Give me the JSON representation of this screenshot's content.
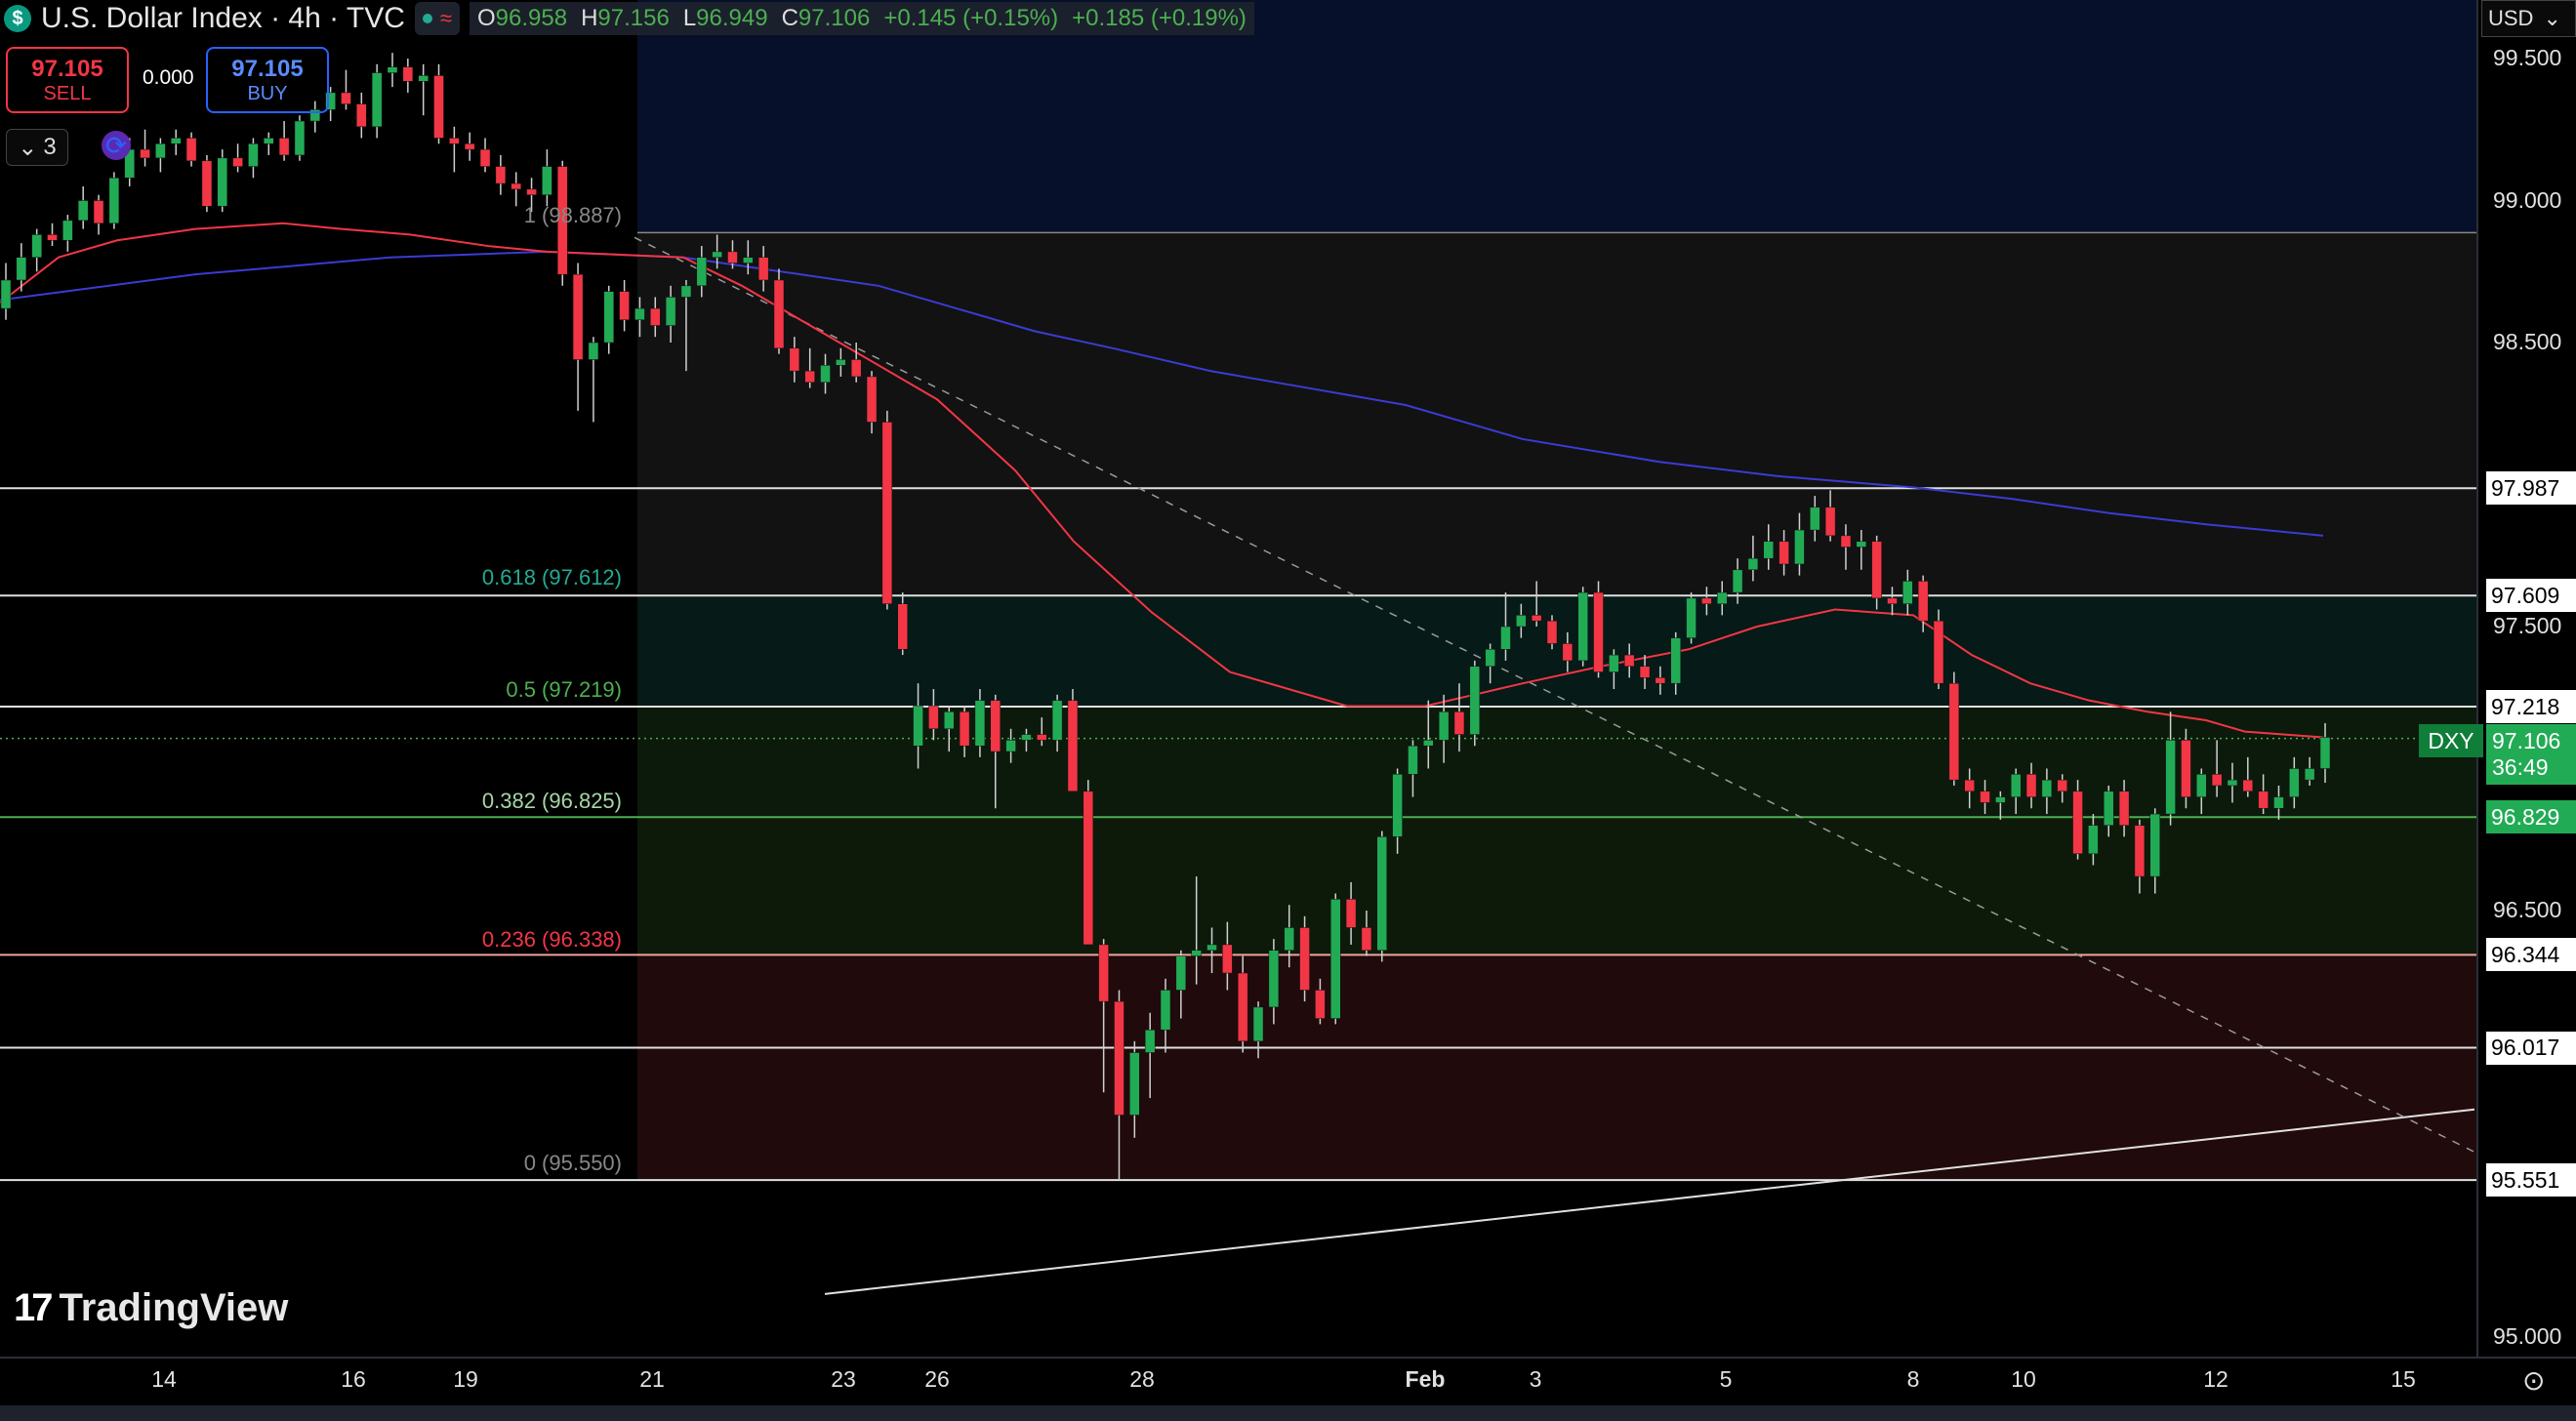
{
  "header": {
    "logo": "$",
    "title": "U.S. Dollar Index · 4h · TVC",
    "open_label": "O",
    "open": "96.958",
    "high_label": "H",
    "high": "97.156",
    "low_label": "L",
    "low": "96.949",
    "close_label": "C",
    "close": "97.106",
    "change": "+0.145 (+0.15%)",
    "change2": "+0.185 (+0.19%)",
    "currency": "USD"
  },
  "trade": {
    "sell_price": "97.105",
    "sell_label": "SELL",
    "spread": "0.000",
    "buy_price": "97.105",
    "buy_label": "BUY"
  },
  "controls": {
    "indicator_count": "3",
    "chevron": "⌄"
  },
  "watermark": "TradingView",
  "colors": {
    "up": "#22ab55",
    "down": "#f23645",
    "ema_fast": "#f23645",
    "ema_slow": "#3b3bd4",
    "fib_red": "#f23645",
    "fib_green": "#4caf50"
  },
  "chart_data": {
    "type": "candlestick",
    "symbol": "DXY",
    "timeframe": "4h",
    "ylim": [
      95.0,
      99.5
    ],
    "y_ticks": [
      "99.500",
      "99.000",
      "98.500",
      "97.500",
      "96.500",
      "95.000"
    ],
    "x_ticks": [
      "14",
      "16",
      "19",
      "21",
      "23",
      "26",
      "28",
      "Feb",
      "3",
      "5",
      "8",
      "10",
      "12",
      "15"
    ],
    "fib_levels": [
      {
        "ratio": "1",
        "label": "1 (98.887)",
        "value": 98.887
      },
      {
        "ratio": "0.618",
        "label": "0.618 (97.612)",
        "value": 97.612
      },
      {
        "ratio": "0.5",
        "label": "0.5 (97.219)",
        "value": 97.219
      },
      {
        "ratio": "0.382",
        "label": "0.382 (96.825)",
        "value": 96.825
      },
      {
        "ratio": "0.236",
        "label": "0.236 (96.338)",
        "value": 96.338
      },
      {
        "ratio": "0",
        "label": "0 (95.550)",
        "value": 95.55
      }
    ],
    "horizontal_levels": [
      "97.987",
      "97.609",
      "97.218",
      "96.829",
      "96.344",
      "96.017",
      "95.551"
    ],
    "current": {
      "label": "DXY",
      "price": "97.106",
      "countdown": "36:49"
    },
    "candles": [
      [
        98.62,
        98.78,
        98.58,
        98.72
      ],
      [
        98.72,
        98.85,
        98.68,
        98.8
      ],
      [
        98.8,
        98.9,
        98.75,
        98.88
      ],
      [
        98.88,
        98.92,
        98.84,
        98.86
      ],
      [
        98.86,
        98.95,
        98.82,
        98.93
      ],
      [
        98.93,
        99.05,
        98.9,
        99.0
      ],
      [
        99.0,
        99.02,
        98.88,
        98.92
      ],
      [
        98.92,
        99.1,
        98.9,
        99.08
      ],
      [
        99.08,
        99.22,
        99.05,
        99.18
      ],
      [
        99.18,
        99.25,
        99.12,
        99.15
      ],
      [
        99.15,
        99.22,
        99.1,
        99.2
      ],
      [
        99.2,
        99.25,
        99.16,
        99.22
      ],
      [
        99.22,
        99.24,
        99.12,
        99.14
      ],
      [
        99.14,
        99.16,
        98.96,
        98.98
      ],
      [
        98.98,
        99.18,
        98.96,
        99.15
      ],
      [
        99.15,
        99.2,
        99.1,
        99.12
      ],
      [
        99.12,
        99.22,
        99.08,
        99.2
      ],
      [
        99.2,
        99.24,
        99.16,
        99.22
      ],
      [
        99.22,
        99.28,
        99.14,
        99.16
      ],
      [
        99.16,
        99.3,
        99.14,
        99.28
      ],
      [
        99.28,
        99.35,
        99.24,
        99.32
      ],
      [
        99.32,
        99.4,
        99.28,
        99.38
      ],
      [
        99.38,
        99.46,
        99.32,
        99.34
      ],
      [
        99.34,
        99.38,
        99.22,
        99.26
      ],
      [
        99.26,
        99.48,
        99.22,
        99.45
      ],
      [
        99.45,
        99.52,
        99.4,
        99.47
      ],
      [
        99.47,
        99.5,
        99.38,
        99.42
      ],
      [
        99.42,
        99.48,
        99.3,
        99.44
      ],
      [
        99.44,
        99.48,
        99.2,
        99.22
      ],
      [
        99.22,
        99.26,
        99.1,
        99.2
      ],
      [
        99.2,
        99.24,
        99.14,
        99.18
      ],
      [
        99.18,
        99.22,
        99.1,
        99.12
      ],
      [
        99.12,
        99.16,
        99.02,
        99.06
      ],
      [
        99.06,
        99.1,
        98.98,
        99.04
      ],
      [
        99.04,
        99.08,
        98.96,
        99.02
      ],
      [
        99.02,
        99.18,
        98.98,
        99.12
      ],
      [
        99.12,
        99.14,
        98.7,
        98.74
      ],
      [
        98.74,
        98.78,
        98.26,
        98.44
      ],
      [
        98.44,
        98.52,
        98.22,
        98.5
      ],
      [
        98.5,
        98.7,
        98.46,
        98.68
      ],
      [
        98.68,
        98.72,
        98.54,
        98.58
      ],
      [
        98.58,
        98.66,
        98.52,
        98.62
      ],
      [
        98.62,
        98.66,
        98.52,
        98.56
      ],
      [
        98.56,
        98.7,
        98.5,
        98.66
      ],
      [
        98.66,
        98.72,
        98.4,
        98.7
      ],
      [
        98.7,
        98.84,
        98.66,
        98.8
      ],
      [
        98.8,
        98.88,
        98.76,
        98.82
      ],
      [
        98.82,
        98.86,
        98.76,
        98.78
      ],
      [
        98.78,
        98.86,
        98.74,
        98.8
      ],
      [
        98.8,
        98.84,
        98.68,
        98.72
      ],
      [
        98.72,
        98.76,
        98.46,
        98.48
      ],
      [
        98.48,
        98.52,
        98.36,
        98.4
      ],
      [
        98.4,
        98.48,
        98.34,
        98.36
      ],
      [
        98.36,
        98.46,
        98.32,
        98.42
      ],
      [
        98.42,
        98.48,
        98.38,
        98.44
      ],
      [
        98.44,
        98.5,
        98.36,
        98.38
      ],
      [
        98.38,
        98.4,
        98.18,
        98.22
      ],
      [
        98.22,
        98.26,
        97.56,
        97.58
      ],
      [
        97.58,
        97.62,
        97.4,
        97.42
      ],
      [
        97.08,
        97.3,
        97.0,
        97.22
      ],
      [
        97.22,
        97.28,
        97.1,
        97.14
      ],
      [
        97.14,
        97.22,
        97.06,
        97.2
      ],
      [
        97.2,
        97.22,
        97.04,
        97.08
      ],
      [
        97.08,
        97.28,
        97.04,
        97.24
      ],
      [
        97.24,
        97.26,
        96.86,
        97.06
      ],
      [
        97.06,
        97.14,
        97.02,
        97.1
      ],
      [
        97.1,
        97.14,
        97.06,
        97.12
      ],
      [
        97.12,
        97.18,
        97.08,
        97.1
      ],
      [
        97.1,
        97.26,
        97.06,
        97.24
      ],
      [
        97.24,
        97.28,
        96.92,
        96.92
      ],
      [
        96.92,
        96.96,
        96.38,
        96.38
      ],
      [
        96.38,
        96.4,
        95.86,
        96.18
      ],
      [
        96.18,
        96.22,
        95.55,
        95.78
      ],
      [
        95.78,
        96.04,
        95.7,
        96.0
      ],
      [
        96.0,
        96.14,
        95.84,
        96.08
      ],
      [
        96.08,
        96.26,
        96.0,
        96.22
      ],
      [
        96.22,
        96.36,
        96.12,
        96.34
      ],
      [
        96.34,
        96.62,
        96.24,
        96.36
      ],
      [
        96.36,
        96.44,
        96.28,
        96.38
      ],
      [
        96.38,
        96.46,
        96.22,
        96.28
      ],
      [
        96.28,
        96.34,
        96.0,
        96.04
      ],
      [
        96.04,
        96.18,
        95.98,
        96.16
      ],
      [
        96.16,
        96.4,
        96.1,
        96.36
      ],
      [
        96.36,
        96.52,
        96.3,
        96.44
      ],
      [
        96.44,
        96.48,
        96.18,
        96.22
      ],
      [
        96.22,
        96.26,
        96.1,
        96.12
      ],
      [
        96.12,
        96.56,
        96.1,
        96.54
      ],
      [
        96.54,
        96.6,
        96.38,
        96.44
      ],
      [
        96.44,
        96.5,
        96.34,
        96.36
      ],
      [
        96.36,
        96.78,
        96.32,
        96.76
      ],
      [
        96.76,
        97.0,
        96.7,
        96.98
      ],
      [
        96.98,
        97.1,
        96.9,
        97.08
      ],
      [
        97.08,
        97.24,
        97.0,
        97.1
      ],
      [
        97.1,
        97.26,
        97.02,
        97.2
      ],
      [
        97.2,
        97.3,
        97.06,
        97.12
      ],
      [
        97.12,
        97.38,
        97.08,
        97.36
      ],
      [
        97.36,
        97.44,
        97.3,
        97.42
      ],
      [
        97.42,
        97.62,
        97.38,
        97.5
      ],
      [
        97.5,
        97.58,
        97.46,
        97.54
      ],
      [
        97.54,
        97.66,
        97.5,
        97.52
      ],
      [
        97.52,
        97.54,
        97.42,
        97.44
      ],
      [
        97.44,
        97.48,
        97.34,
        97.38
      ],
      [
        97.38,
        97.64,
        97.36,
        97.62
      ],
      [
        97.62,
        97.66,
        97.32,
        97.34
      ],
      [
        97.34,
        97.42,
        97.28,
        97.4
      ],
      [
        97.4,
        97.44,
        97.32,
        97.36
      ],
      [
        97.36,
        97.4,
        97.28,
        97.32
      ],
      [
        97.32,
        97.36,
        97.26,
        97.3
      ],
      [
        97.3,
        97.48,
        97.26,
        97.46
      ],
      [
        97.46,
        97.62,
        97.44,
        97.6
      ],
      [
        97.6,
        97.64,
        97.54,
        97.58
      ],
      [
        97.58,
        97.66,
        97.54,
        97.62
      ],
      [
        97.62,
        97.74,
        97.58,
        97.7
      ],
      [
        97.7,
        97.82,
        97.66,
        97.74
      ],
      [
        97.74,
        97.86,
        97.7,
        97.8
      ],
      [
        97.8,
        97.84,
        97.68,
        97.72
      ],
      [
        97.72,
        97.9,
        97.68,
        97.84
      ],
      [
        97.84,
        97.96,
        97.8,
        97.92
      ],
      [
        97.92,
        97.98,
        97.8,
        97.82
      ],
      [
        97.82,
        97.86,
        97.7,
        97.78
      ],
      [
        97.78,
        97.84,
        97.7,
        97.8
      ],
      [
        97.8,
        97.82,
        97.56,
        97.6
      ],
      [
        97.6,
        97.64,
        97.54,
        97.58
      ],
      [
        97.58,
        97.7,
        97.54,
        97.66
      ],
      [
        97.66,
        97.68,
        97.48,
        97.52
      ],
      [
        97.52,
        97.56,
        97.28,
        97.3
      ],
      [
        97.3,
        97.34,
        96.94,
        96.96
      ],
      [
        96.96,
        97.0,
        96.86,
        96.92
      ],
      [
        96.92,
        96.96,
        96.84,
        96.88
      ],
      [
        96.88,
        96.92,
        96.82,
        96.9
      ],
      [
        96.9,
        97.0,
        96.84,
        96.98
      ],
      [
        96.98,
        97.02,
        96.86,
        96.9
      ],
      [
        96.9,
        97.0,
        96.84,
        96.96
      ],
      [
        96.96,
        96.98,
        96.88,
        96.92
      ],
      [
        96.92,
        96.96,
        96.68,
        96.7
      ],
      [
        96.7,
        96.84,
        96.66,
        96.8
      ],
      [
        96.8,
        96.94,
        96.76,
        96.92
      ],
      [
        96.92,
        96.96,
        96.76,
        96.8
      ],
      [
        96.8,
        96.82,
        96.56,
        96.62
      ],
      [
        96.62,
        96.86,
        96.56,
        96.84
      ],
      [
        96.84,
        97.2,
        96.8,
        97.1
      ],
      [
        97.1,
        97.14,
        96.86,
        96.9
      ],
      [
        96.9,
        97.0,
        96.84,
        96.98
      ],
      [
        96.98,
        97.1,
        96.9,
        96.94
      ],
      [
        96.94,
        97.02,
        96.88,
        96.96
      ],
      [
        96.96,
        97.04,
        96.9,
        96.92
      ],
      [
        96.92,
        96.98,
        96.84,
        96.86
      ],
      [
        96.86,
        96.94,
        96.82,
        96.9
      ],
      [
        96.9,
        97.04,
        96.86,
        97.0
      ],
      [
        96.96,
        97.04,
        96.94,
        97.0
      ],
      [
        97.0,
        97.16,
        96.95,
        97.11
      ]
    ],
    "ema_fast": [
      [
        0,
        98.64
      ],
      [
        60,
        98.8
      ],
      [
        120,
        98.86
      ],
      [
        200,
        98.9
      ],
      [
        290,
        98.92
      ],
      [
        350,
        98.9
      ],
      [
        420,
        98.88
      ],
      [
        500,
        98.84
      ],
      [
        560,
        98.82
      ],
      [
        700,
        98.8
      ],
      [
        760,
        98.7
      ],
      [
        860,
        98.5
      ],
      [
        960,
        98.3
      ],
      [
        1040,
        98.05
      ],
      [
        1100,
        97.8
      ],
      [
        1180,
        97.55
      ],
      [
        1260,
        97.34
      ],
      [
        1380,
        97.22
      ],
      [
        1460,
        97.22
      ],
      [
        1560,
        97.3
      ],
      [
        1640,
        97.36
      ],
      [
        1730,
        97.42
      ],
      [
        1800,
        97.5
      ],
      [
        1880,
        97.56
      ],
      [
        1960,
        97.54
      ],
      [
        2020,
        97.4
      ],
      [
        2080,
        97.3
      ],
      [
        2140,
        97.24
      ],
      [
        2200,
        97.2
      ],
      [
        2260,
        97.17
      ],
      [
        2300,
        97.13
      ],
      [
        2380,
        97.11
      ]
    ],
    "ema_slow": [
      [
        0,
        98.65
      ],
      [
        200,
        98.74
      ],
      [
        400,
        98.8
      ],
      [
        560,
        98.82
      ],
      [
        700,
        98.8
      ],
      [
        820,
        98.74
      ],
      [
        900,
        98.7
      ],
      [
        980,
        98.62
      ],
      [
        1060,
        98.54
      ],
      [
        1140,
        98.48
      ],
      [
        1240,
        98.4
      ],
      [
        1340,
        98.34
      ],
      [
        1440,
        98.28
      ],
      [
        1560,
        98.16
      ],
      [
        1700,
        98.08
      ],
      [
        1820,
        98.03
      ],
      [
        1960,
        97.99
      ],
      [
        2060,
        97.95
      ],
      [
        2160,
        97.9
      ],
      [
        2260,
        97.86
      ],
      [
        2380,
        97.82
      ]
    ],
    "trendline": {
      "from": [
        845,
        95.15
      ],
      "to": [
        2535,
        95.8
      ]
    },
    "dashed_line": {
      "from": [
        650,
        98.87
      ],
      "to": [
        2535,
        95.65
      ]
    }
  }
}
